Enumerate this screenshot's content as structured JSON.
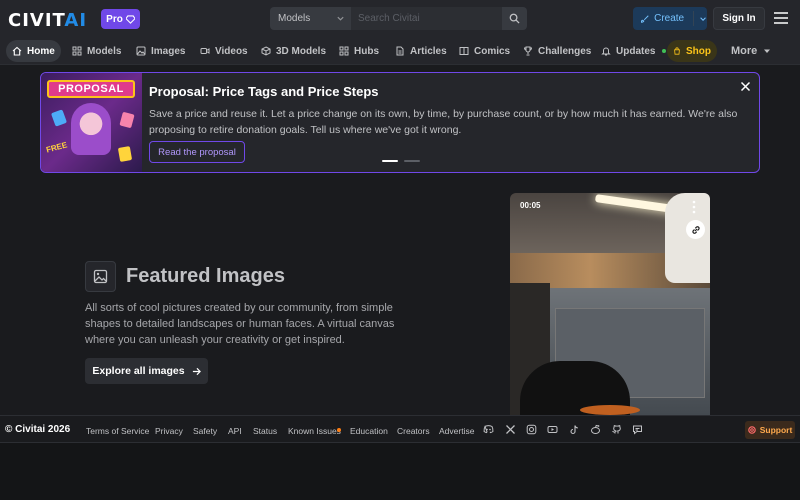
{
  "header": {
    "logo_main": "CIVIT",
    "logo_accent": "AI",
    "pro_label": "Pro",
    "search_select": "Models",
    "search_placeholder": "Search Civitai",
    "search_shortcut": "/",
    "create_label": "Create",
    "signin_label": "Sign In"
  },
  "nav": {
    "items": [
      {
        "label": "Home",
        "icon": "home-icon"
      },
      {
        "label": "Models",
        "icon": "grid-icon"
      },
      {
        "label": "Images",
        "icon": "image-icon"
      },
      {
        "label": "Videos",
        "icon": "video-icon"
      },
      {
        "label": "3D Models",
        "icon": "cube-icon"
      },
      {
        "label": "Hubs",
        "icon": "grid-icon"
      },
      {
        "label": "Articles",
        "icon": "article-icon"
      },
      {
        "label": "Comics",
        "icon": "book-icon"
      },
      {
        "label": "Challenges",
        "icon": "trophy-icon"
      },
      {
        "label": "Updates",
        "icon": "bell-icon"
      },
      {
        "label": "Shop",
        "icon": "bag-icon"
      },
      {
        "label": "More",
        "icon": "caret-down-icon"
      }
    ],
    "active": "Home"
  },
  "banner": {
    "image_sign": "PROPOSAL",
    "image_free": "FREE",
    "title": "Proposal: Price Tags and Price Steps",
    "text": "Save a price and reuse it. Let a price change on its own, by time, by purchase count, or by how much it has earned. We're also proposing to retire donation goals. Tell us where we've got it wrong.",
    "button": "Read the proposal",
    "slides": 2,
    "current_slide": 1
  },
  "featured": {
    "title": "Featured Images",
    "description": "All sorts of cool pictures created by our community, from simple shapes to detailed landscapes or human faces. A virtual canvas where you can unleash your creativity or get inspired.",
    "button": "Explore all images"
  },
  "video_card": {
    "duration": "00:05"
  },
  "footer": {
    "copyright": "© Civitai 2026",
    "links": [
      "Terms of Service",
      "Privacy",
      "Safety",
      "API",
      "Status",
      "Known Issues",
      "Education",
      "Creators",
      "Advertise"
    ],
    "social_icons": [
      "discord-icon",
      "x-icon",
      "instagram-icon",
      "youtube-icon",
      "tiktok-icon",
      "reddit-icon",
      "github-icon",
      "chat-icon"
    ],
    "support_label": "Support"
  },
  "colors": {
    "accent_blue": "#228be6",
    "pro_purple": "#7048e8",
    "shop_yellow": "#fcc419",
    "support_orange": "#ffa94d"
  }
}
